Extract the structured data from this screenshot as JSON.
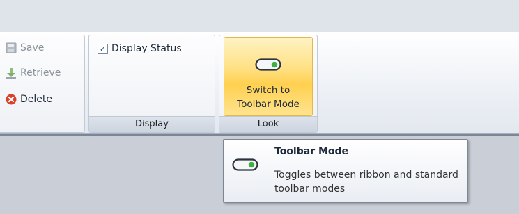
{
  "file_group": {
    "commands": [
      {
        "label": "Save",
        "icon": "save-icon",
        "enabled": false
      },
      {
        "label": "Retrieve",
        "icon": "retrieve-icon",
        "enabled": false
      },
      {
        "label": "Delete",
        "icon": "delete-icon",
        "enabled": true
      }
    ]
  },
  "display_group": {
    "label": "Display",
    "display_status": {
      "label": "Display Status",
      "checked": true
    }
  },
  "look_group": {
    "label": "Look",
    "switch_button": {
      "line1": "Switch to",
      "line2": "Toolbar Mode",
      "icon": "toggle-switch-icon"
    }
  },
  "tooltip": {
    "title": "Toolbar Mode",
    "body": "Toggles between ribbon and standard toolbar modes",
    "icon": "toggle-switch-icon"
  },
  "colors": {
    "highlight": "#ffd04f",
    "toggle_green": "#3cb043",
    "delete_red": "#d9412b"
  }
}
